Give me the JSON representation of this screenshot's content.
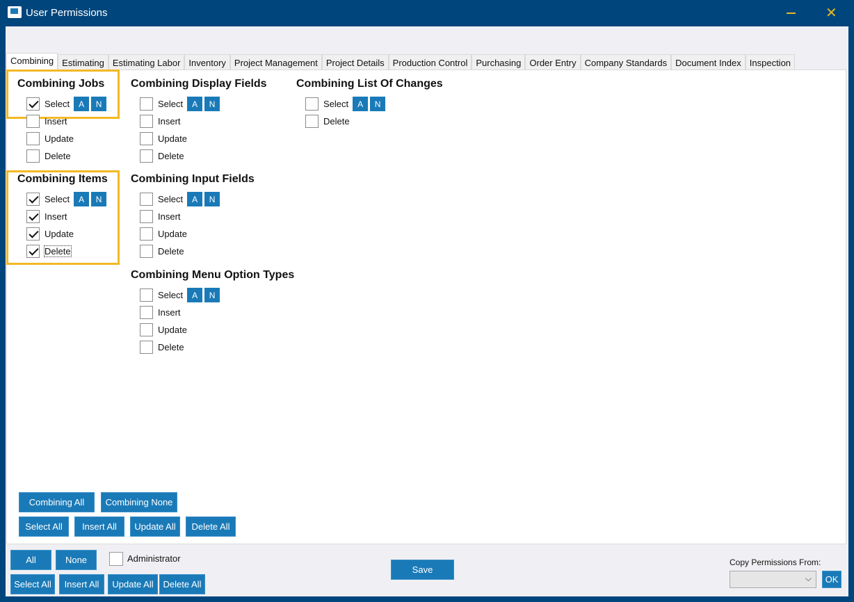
{
  "window": {
    "title": "User Permissions"
  },
  "tabs": [
    "Combining",
    "Estimating",
    "Estimating Labor",
    "Inventory",
    "Project Management",
    "Project Details",
    "Production Control",
    "Purchasing",
    "Order Entry",
    "Company Standards",
    "Document Index",
    "Inspection"
  ],
  "labels": {
    "select": "Select",
    "insert": "Insert",
    "update": "Update",
    "delete": "Delete",
    "all_btn": "A",
    "none_btn": "N"
  },
  "groups": [
    {
      "title": "Combining Jobs",
      "perms": {
        "select": true,
        "insert": false,
        "update": false,
        "delete": false
      }
    },
    {
      "title": "Combining Items",
      "perms": {
        "select": true,
        "insert": true,
        "update": true,
        "delete": true
      }
    },
    {
      "title": "Combining Display Fields",
      "perms": {
        "select": false,
        "insert": false,
        "update": false,
        "delete": false
      }
    },
    {
      "title": "Combining Input Fields",
      "perms": {
        "select": false,
        "insert": false,
        "update": false,
        "delete": false
      }
    },
    {
      "title": "Combining Menu Option Types",
      "perms": {
        "select": false,
        "insert": false,
        "update": false,
        "delete": false
      }
    },
    {
      "title": "Combining List Of Changes",
      "perms": {
        "select": false,
        "delete": false
      }
    }
  ],
  "panel_buttons": {
    "combining_all": "Combining All",
    "combining_none": "Combining None",
    "select_all": "Select All",
    "insert_all": "Insert All",
    "update_all": "Update All",
    "delete_all": "Delete All"
  },
  "footer": {
    "all": "All",
    "none": "None",
    "administrator": "Administrator",
    "administrator_checked": false,
    "select_all": "Select All",
    "insert_all": "Insert All",
    "update_all": "Update All",
    "delete_all": "Delete All",
    "save": "Save",
    "copy_from_label": "Copy Permissions From:",
    "copy_from_value": "",
    "ok": "OK"
  }
}
